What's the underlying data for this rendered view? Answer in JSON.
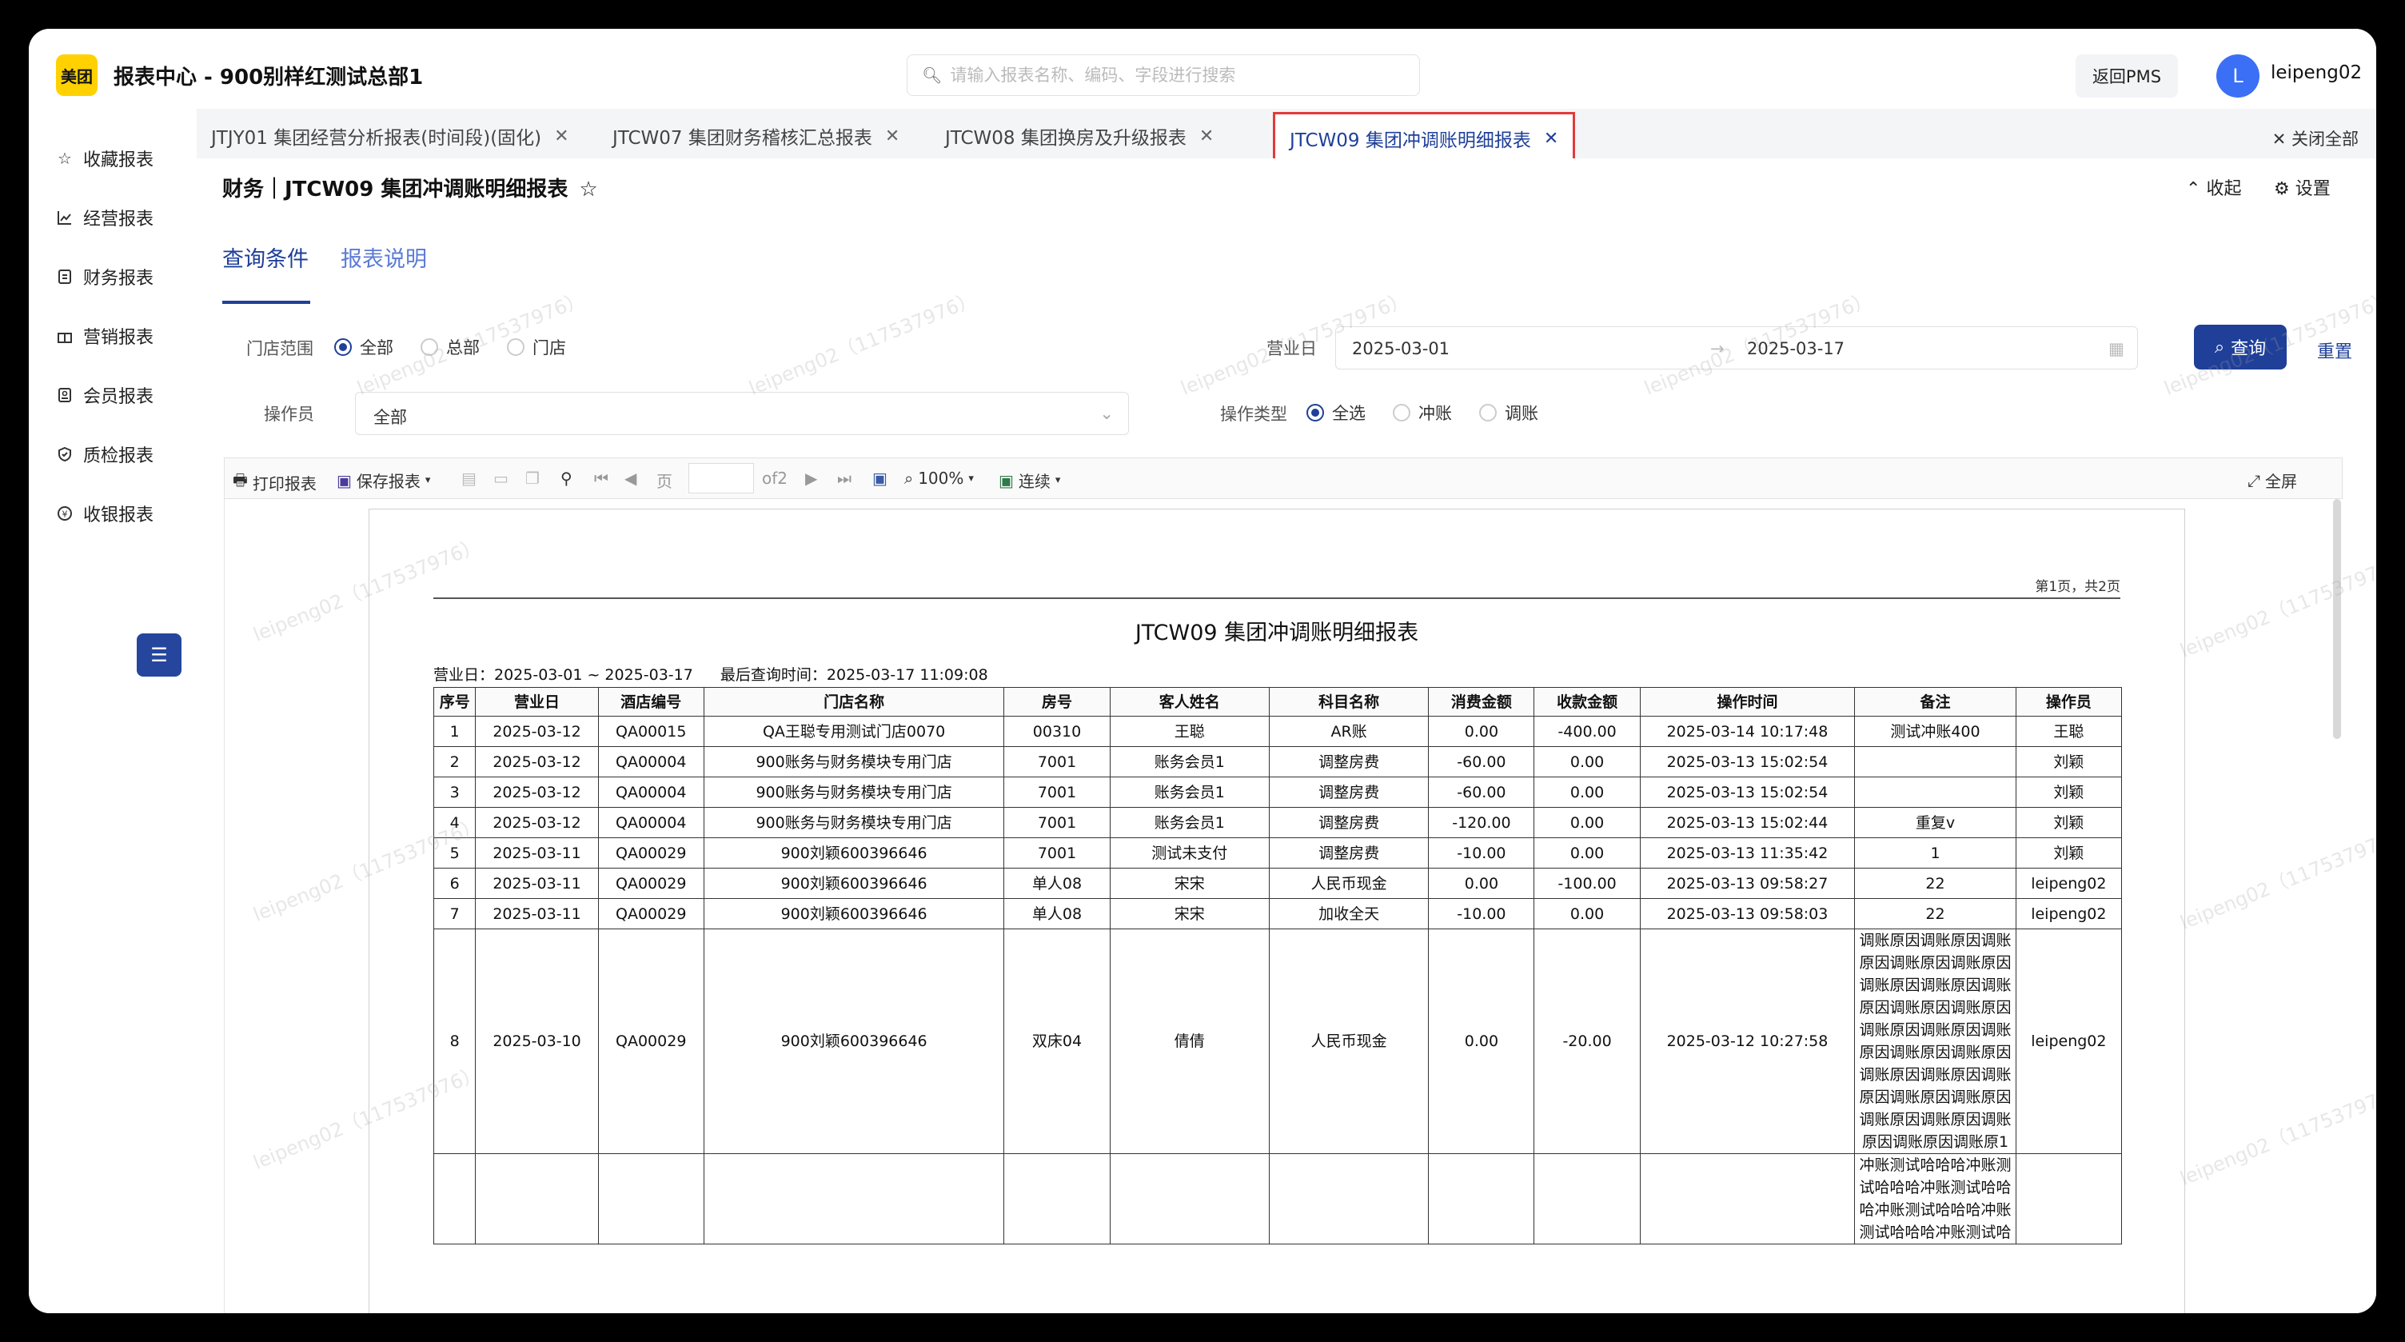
{
  "header": {
    "logo": "美团",
    "title": "报表中心 - 900别样红测试总部1",
    "search_placeholder": "请输入报表名称、编码、字段进行搜索",
    "pms_button": "返回PMS",
    "avatar_letter": "L",
    "username": "leipeng02"
  },
  "sidebar": {
    "items": [
      {
        "label": "收藏报表",
        "icon": "star-icon"
      },
      {
        "label": "经营报表",
        "icon": "chart-icon"
      },
      {
        "label": "财务报表",
        "icon": "finance-icon"
      },
      {
        "label": "营销报表",
        "icon": "gift-icon"
      },
      {
        "label": "会员报表",
        "icon": "member-icon"
      },
      {
        "label": "质检报表",
        "icon": "shield-icon"
      },
      {
        "label": "收银报表",
        "icon": "yen-icon"
      }
    ]
  },
  "tabs": [
    {
      "label": "JTJY01 集团经营分析报表(时间段)(固化)"
    },
    {
      "label": "JTCW07 集团财务稽核汇总报表"
    },
    {
      "label": "JTCW08 集团换房及升级报表"
    },
    {
      "label": "JTCW09 集团冲调账明细报表",
      "active": true
    }
  ],
  "close_all": "关闭全部",
  "page": {
    "title": "财务｜JTCW09 集团冲调账明细报表",
    "collapse": "收起",
    "settings": "设置",
    "query_tab": "查询条件",
    "desc_tab": "报表说明"
  },
  "filters": {
    "store_scope_label": "门店范围",
    "store_scope_options": [
      "全部",
      "总部",
      "门店"
    ],
    "business_day_label": "营业日",
    "date_start": "2025-03-01",
    "date_end": "2025-03-17",
    "operator_label": "操作员",
    "operator_value": "全部",
    "op_type_label": "操作类型",
    "op_type_options": [
      "全选",
      "冲账",
      "调账"
    ],
    "query_button": "查询",
    "reset_button": "重置"
  },
  "toolbar": {
    "print": "打印报表",
    "save": "保存报表",
    "page_label": "页",
    "of_pages": "of2",
    "zoom": "100%",
    "mode": "连续",
    "fullscreen": "全屏"
  },
  "report": {
    "page_info": "第1页，共2页",
    "title": "JTCW09 集团冲调账明细报表",
    "business_day": "营业日：2025-03-01 ~ 2025-03-17",
    "last_query": "最后查询时间：2025-03-17 11:09:08",
    "columns": [
      "序号",
      "营业日",
      "酒店编号",
      "门店名称",
      "房号",
      "客人姓名",
      "科目名称",
      "消费金额",
      "收款金额",
      "操作时间",
      "备注",
      "操作员"
    ],
    "rows": [
      [
        "1",
        "2025-03-12",
        "QA00015",
        "QA王聪专用测试门店0070",
        "00310",
        "王聪",
        "AR账",
        "0.00",
        "-400.00",
        "2025-03-14 10:17:48",
        "测试冲账400",
        "王聪"
      ],
      [
        "2",
        "2025-03-12",
        "QA00004",
        "900账务与财务模块专用门店",
        "7001",
        "账务会员1",
        "调整房费",
        "-60.00",
        "0.00",
        "2025-03-13 15:02:54",
        "",
        "刘颖"
      ],
      [
        "3",
        "2025-03-12",
        "QA00004",
        "900账务与财务模块专用门店",
        "7001",
        "账务会员1",
        "调整房费",
        "-60.00",
        "0.00",
        "2025-03-13 15:02:54",
        "",
        "刘颖"
      ],
      [
        "4",
        "2025-03-12",
        "QA00004",
        "900账务与财务模块专用门店",
        "7001",
        "账务会员1",
        "调整房费",
        "-120.00",
        "0.00",
        "2025-03-13 15:02:44",
        "重复v",
        "刘颖"
      ],
      [
        "5",
        "2025-03-11",
        "QA00029",
        "900刘颖600396646",
        "7001",
        "测试未支付",
        "调整房费",
        "-10.00",
        "0.00",
        "2025-03-13 11:35:42",
        "1",
        "刘颖"
      ],
      [
        "6",
        "2025-03-11",
        "QA00029",
        "900刘颖600396646",
        "单人08",
        "宋宋",
        "人民币现金",
        "0.00",
        "-100.00",
        "2025-03-13 09:58:27",
        "22",
        "leipeng02"
      ],
      [
        "7",
        "2025-03-11",
        "QA00029",
        "900刘颖600396646",
        "单人08",
        "宋宋",
        "加收全天",
        "-10.00",
        "0.00",
        "2025-03-13 09:58:03",
        "22",
        "leipeng02"
      ],
      [
        "8",
        "2025-03-10",
        "QA00029",
        "900刘颖600396646",
        "双床04",
        "倩倩",
        "人民币现金",
        "0.00",
        "-20.00",
        "2025-03-12 10:27:58",
        "调账原因调账原因调账原因调账原因调账原因调账原因调账原因调账原因调账原因调账原因调账原因调账原因调账原因调账原因调账原因调账原因调账原因调账原因调账原因调账原因调账原因调账原因调账原因调账原因调账原1",
        "leipeng02"
      ],
      [
        "",
        "",
        "",
        "",
        "",
        "",
        "",
        "",
        "",
        "",
        "冲账测试哈哈哈冲账测试哈哈哈冲账测试哈哈哈冲账测试哈哈哈冲账测试哈哈哈冲账测试哈",
        ""
      ]
    ]
  },
  "watermark": "leipeng02（117537976）"
}
